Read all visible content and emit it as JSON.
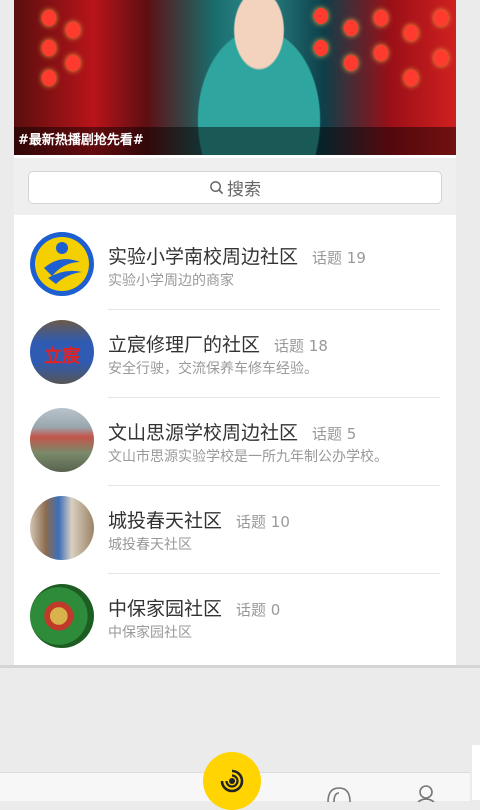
{
  "banner": {
    "caption": "#最新热播剧抢先看#"
  },
  "search": {
    "label": "搜索"
  },
  "communities": [
    {
      "name": "实验小学南校周边社区",
      "count_label": "话题 19",
      "desc": "实验小学周边的商家"
    },
    {
      "name": "立宸修理厂的社区",
      "count_label": "话题 18",
      "desc": "安全行驶，交流保养车修车经验。"
    },
    {
      "name": "文山思源学校周边社区",
      "count_label": "话题 5",
      "desc": "文山市思源实验学校是一所九年制公办学校。"
    },
    {
      "name": "城投春天社区",
      "count_label": "话题 10",
      "desc": "城投春天社区"
    },
    {
      "name": "中保家园社区",
      "count_label": "话题 0",
      "desc": "中保家园社区"
    }
  ],
  "avatar_text": {
    "lichen": "立宸"
  },
  "colors": {
    "accent": "#ffd400",
    "avatar_blue": "#1d5fd1"
  }
}
